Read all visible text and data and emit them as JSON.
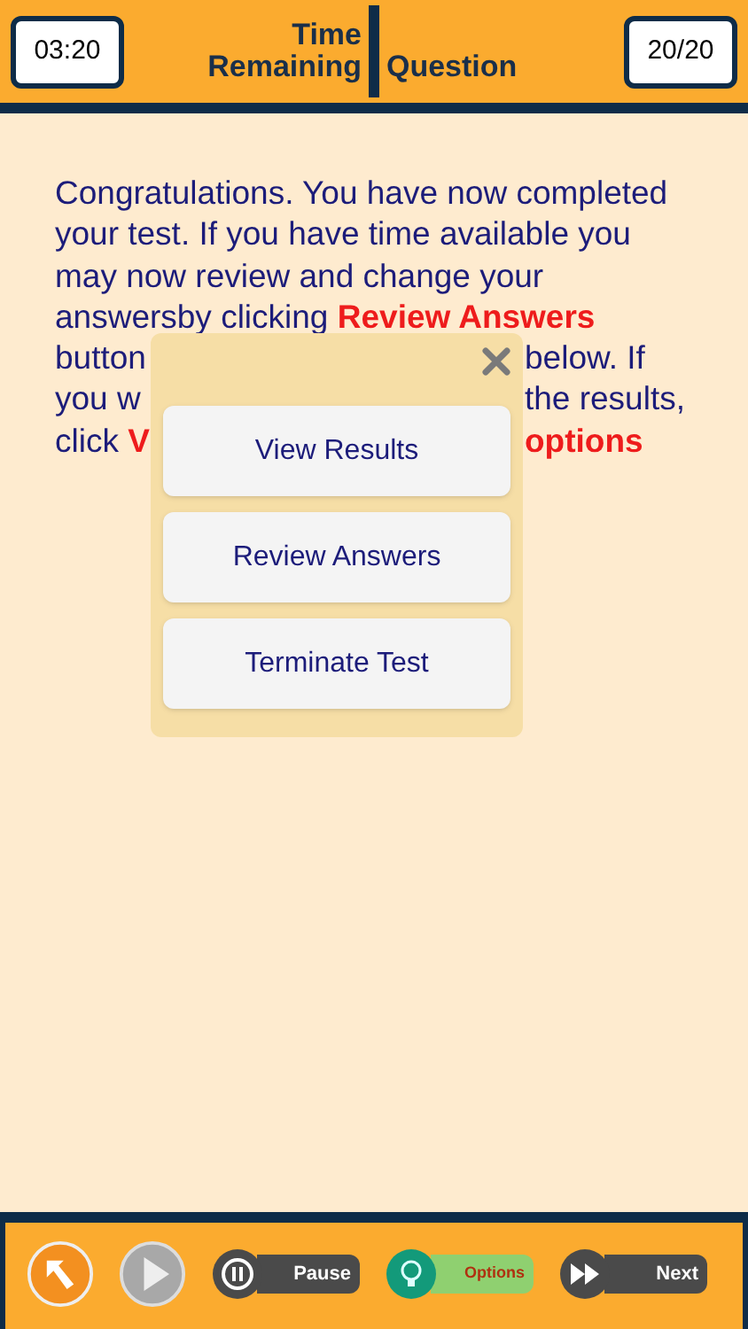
{
  "header": {
    "timer": "03:20",
    "time_label": "Time Remaining",
    "question_label": "Question",
    "question_count": "20/20"
  },
  "message": {
    "lines": [
      {
        "left": [
          {
            "text": "Congratulations. You have now completed",
            "highlight": false
          }
        ]
      },
      {
        "left": [
          {
            "text": "your test. If you have time available you",
            "highlight": false
          }
        ]
      },
      {
        "left": [
          {
            "text": "may now review and change your",
            "highlight": false
          }
        ]
      },
      {
        "left": [
          {
            "text": "answersby clicking ",
            "highlight": false
          },
          {
            "text": "Review Answers",
            "highlight": true
          }
        ]
      },
      {
        "left": [
          {
            "text": "button",
            "highlight": false
          }
        ],
        "right": [
          {
            "text": "below. If",
            "highlight": false
          }
        ]
      },
      {
        "left": [
          {
            "text": "you w",
            "highlight": false
          }
        ],
        "right": [
          {
            "text": "the results,",
            "highlight": false
          }
        ]
      },
      {
        "left": [
          {
            "text": "click ",
            "highlight": false
          },
          {
            "text": "V",
            "highlight": true
          }
        ],
        "right": [
          {
            "text": "options",
            "highlight": true
          }
        ]
      }
    ]
  },
  "dialog": {
    "buttons": [
      "View Results",
      "Review Answers",
      "Terminate Test"
    ]
  },
  "toolbar": [
    {
      "kind": "back"
    },
    {
      "kind": "play"
    },
    {
      "kind": "pause",
      "label": "Pause"
    },
    {
      "kind": "options",
      "label": "Options"
    },
    {
      "kind": "next",
      "label": "Next"
    }
  ]
}
